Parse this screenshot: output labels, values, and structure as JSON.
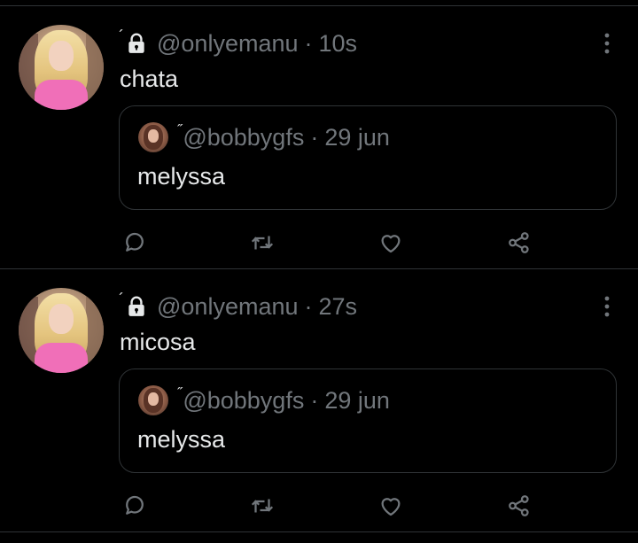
{
  "tweets": [
    {
      "username": "@onlyemanu",
      "separator": "·",
      "time": "10s",
      "text": "chata",
      "quote": {
        "username": "@bobbygfs",
        "separator": "·",
        "time": "29 jun",
        "text": "melyssa"
      }
    },
    {
      "username": "@onlyemanu",
      "separator": "·",
      "time": "27s",
      "text": "micosa",
      "quote": {
        "username": "@bobbygfs",
        "separator": "·",
        "time": "29 jun",
        "text": "melyssa"
      }
    }
  ],
  "icons": {
    "lock": "lock-icon",
    "more": "more-vertical-icon",
    "reply": "reply-icon",
    "retweet": "retweet-icon",
    "like": "heart-icon",
    "share": "share-icon"
  },
  "colors": {
    "background": "#000000",
    "text": "#e7e9ea",
    "secondary": "#71767b",
    "border": "#2f3336"
  }
}
